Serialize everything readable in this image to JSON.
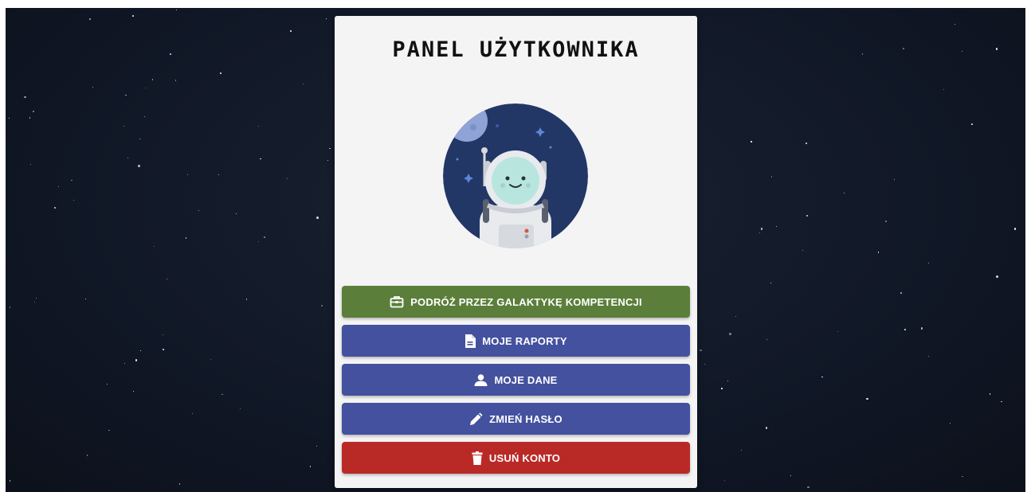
{
  "panel": {
    "title": "PANEL UŻYTKOWNIKA"
  },
  "avatar": {
    "icon": "astronaut-avatar-icon"
  },
  "buttons": [
    {
      "label": "PODRÓŻ PRZEZ GALAKTYKĘ KOMPETENCJI",
      "icon": "briefcase-icon",
      "color": "#5b7f3a"
    },
    {
      "label": "MOJE RAPORTY",
      "icon": "document-icon",
      "color": "#44519f"
    },
    {
      "label": "MOJE DANE",
      "icon": "person-icon",
      "color": "#44519f"
    },
    {
      "label": "ZMIEŃ HASŁO",
      "icon": "pencil-icon",
      "color": "#44519f"
    },
    {
      "label": "USUŃ KONTO",
      "icon": "trash-icon",
      "color": "#b92a27"
    }
  ],
  "colors": {
    "background": "#111827",
    "panel": "#f4f4f4",
    "accent_green": "#5b7f3a",
    "accent_blue": "#44519f",
    "danger_red": "#b92a27"
  }
}
